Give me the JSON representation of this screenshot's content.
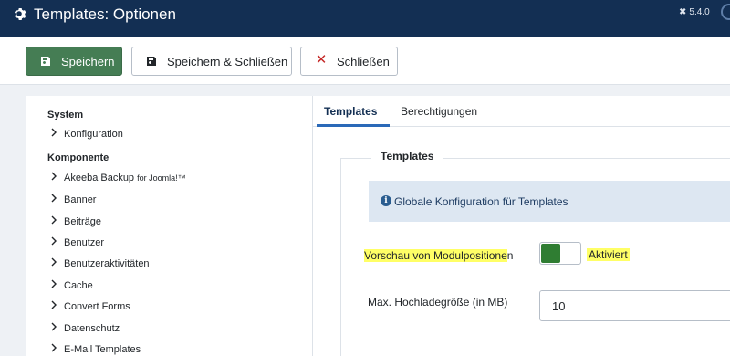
{
  "header": {
    "title": "Templates: Optionen",
    "version": "5.4.0",
    "icons": {
      "title_icon": "gear-icon",
      "version_icon": "joomla-icon"
    }
  },
  "toolbar": {
    "save_label": "Speichern",
    "save_close_label": "Speichern & Schließen",
    "close_label": "Schließen",
    "colors": {
      "save_bg": "#457d54",
      "close_icon": "#c52827"
    }
  },
  "sidebar": {
    "sections": [
      {
        "heading": "System",
        "items": [
          {
            "label": "Konfiguration"
          }
        ]
      },
      {
        "heading": "Komponente",
        "items": [
          {
            "label": "Akeeba Backup",
            "suffix": "for Joomla!™"
          },
          {
            "label": "Banner"
          },
          {
            "label": "Beiträge"
          },
          {
            "label": "Benutzer"
          },
          {
            "label": "Benutzeraktivitäten"
          },
          {
            "label": "Cache"
          },
          {
            "label": "Convert Forms"
          },
          {
            "label": "Datenschutz"
          },
          {
            "label": "E-Mail Templates"
          }
        ]
      }
    ]
  },
  "tabs": [
    {
      "label": "Templates",
      "active": true
    },
    {
      "label": "Berechtigungen",
      "active": false
    }
  ],
  "main": {
    "legend": "Templates",
    "alert_text": "Globale Konfiguration für Templates",
    "preview_label_highlighted": "Vorschau von Modulpositione",
    "preview_label_tail": "n",
    "preview_state": "Aktiviert",
    "preview_enabled": true,
    "upload_label": "Max. Hochladegröße (in MB)",
    "upload_value": "10"
  }
}
